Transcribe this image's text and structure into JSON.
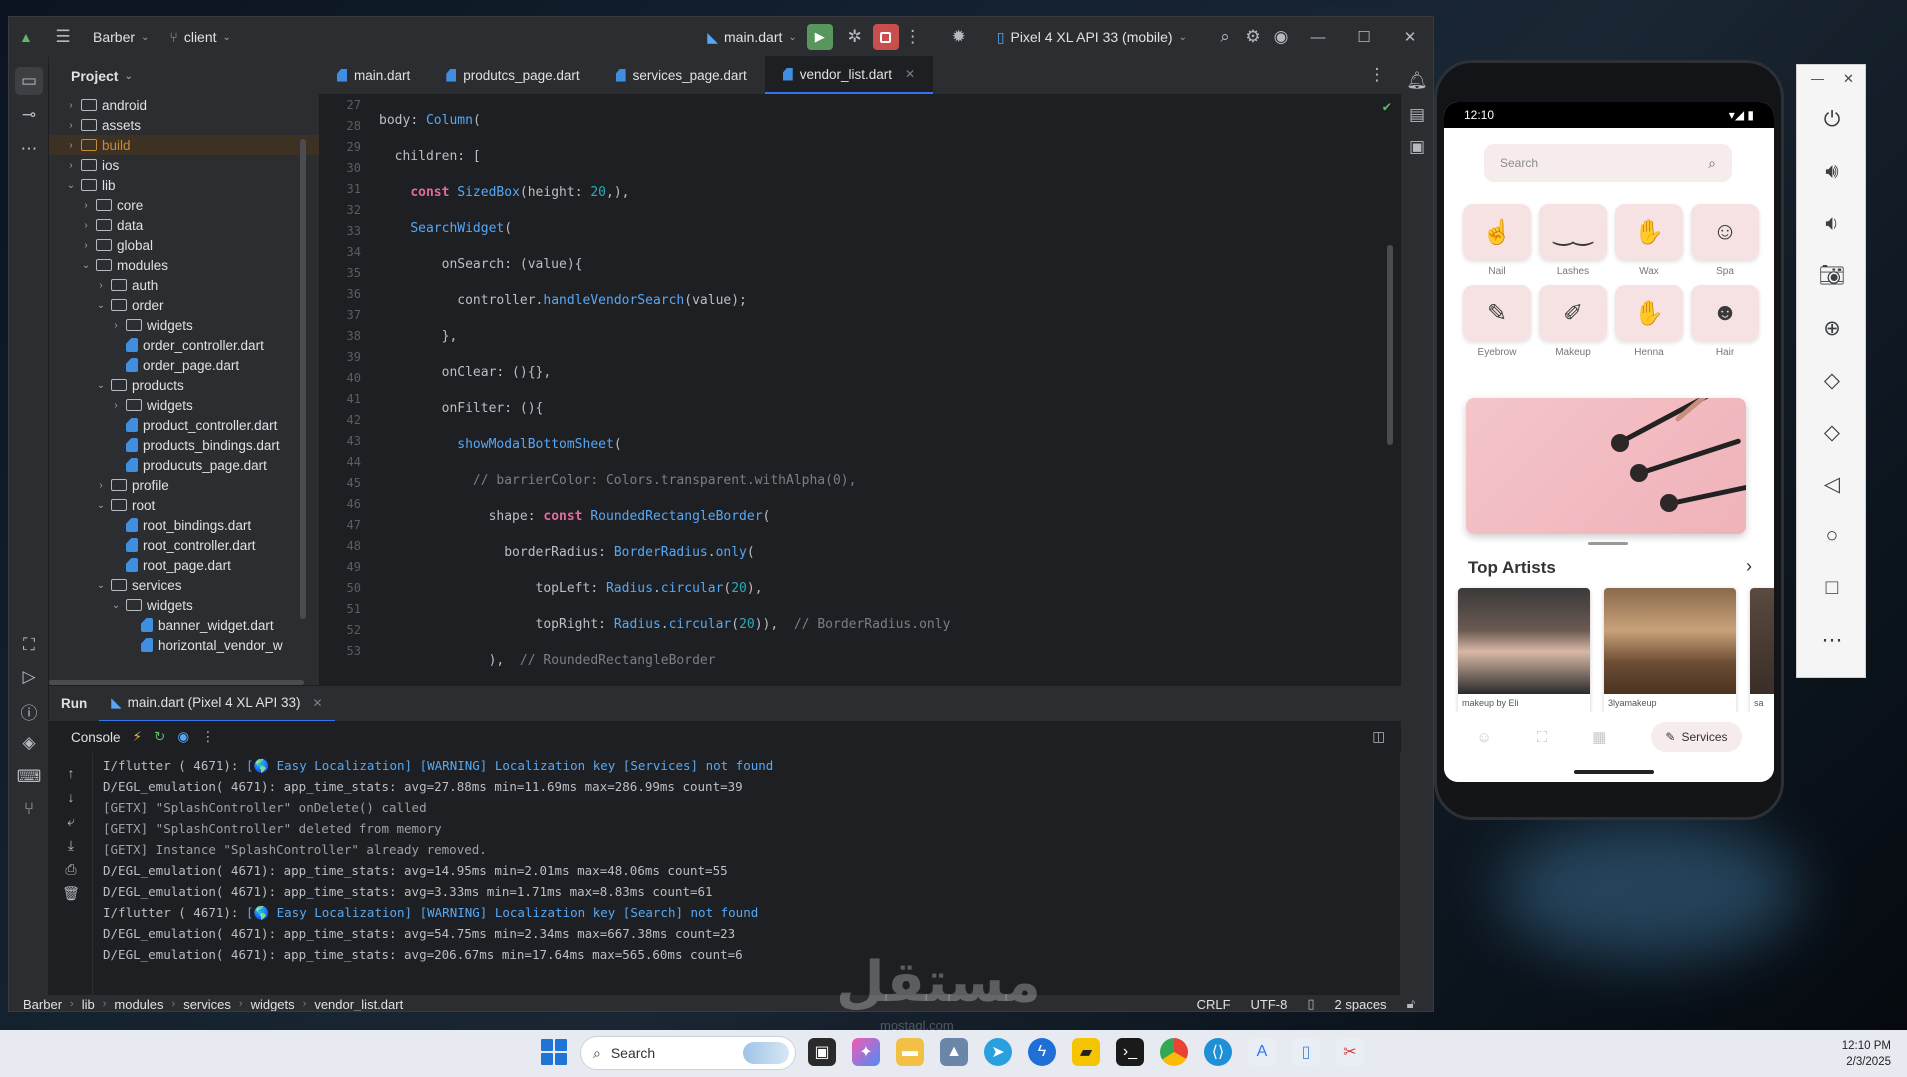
{
  "ide": {
    "project_name": "Barber",
    "vcs_branch": "client",
    "run_config": "main.dart",
    "device": "Pixel 4 XL API 33 (mobile)",
    "project_label": "Project",
    "tabs": [
      {
        "label": "main.dart"
      },
      {
        "label": "produtcs_page.dart"
      },
      {
        "label": "services_page.dart"
      },
      {
        "label": "vendor_list.dart",
        "active": true
      }
    ],
    "tree": [
      {
        "label": "android",
        "depth": 1,
        "type": "folder",
        "arrow": "›"
      },
      {
        "label": "assets",
        "depth": 1,
        "type": "folder",
        "arrow": "›"
      },
      {
        "label": "build",
        "depth": 1,
        "type": "folder-orange",
        "arrow": "›"
      },
      {
        "label": "ios",
        "depth": 1,
        "type": "folder",
        "arrow": "›"
      },
      {
        "label": "lib",
        "depth": 1,
        "type": "folder",
        "arrow": "⌄"
      },
      {
        "label": "core",
        "depth": 2,
        "type": "folder",
        "arrow": "›"
      },
      {
        "label": "data",
        "depth": 2,
        "type": "folder",
        "arrow": "›"
      },
      {
        "label": "global",
        "depth": 2,
        "type": "folder",
        "arrow": "›"
      },
      {
        "label": "modules",
        "depth": 2,
        "type": "folder",
        "arrow": "⌄"
      },
      {
        "label": "auth",
        "depth": 3,
        "type": "folder",
        "arrow": "›"
      },
      {
        "label": "order",
        "depth": 3,
        "type": "folder",
        "arrow": "⌄"
      },
      {
        "label": "widgets",
        "depth": 4,
        "type": "folder",
        "arrow": "›"
      },
      {
        "label": "order_controller.dart",
        "depth": 4,
        "type": "dart",
        "arrow": ""
      },
      {
        "label": "order_page.dart",
        "depth": 4,
        "type": "dart",
        "arrow": ""
      },
      {
        "label": "products",
        "depth": 3,
        "type": "folder",
        "arrow": "⌄"
      },
      {
        "label": "widgets",
        "depth": 4,
        "type": "folder",
        "arrow": "›"
      },
      {
        "label": "product_controller.dart",
        "depth": 4,
        "type": "dart",
        "arrow": ""
      },
      {
        "label": "products_bindings.dart",
        "depth": 4,
        "type": "dart",
        "arrow": ""
      },
      {
        "label": "producuts_page.dart",
        "depth": 4,
        "type": "dart",
        "arrow": ""
      },
      {
        "label": "profile",
        "depth": 3,
        "type": "folder",
        "arrow": "›"
      },
      {
        "label": "root",
        "depth": 3,
        "type": "folder",
        "arrow": "⌄"
      },
      {
        "label": "root_bindings.dart",
        "depth": 4,
        "type": "dart",
        "arrow": ""
      },
      {
        "label": "root_controller.dart",
        "depth": 4,
        "type": "dart",
        "arrow": ""
      },
      {
        "label": "root_page.dart",
        "depth": 4,
        "type": "dart",
        "arrow": ""
      },
      {
        "label": "services",
        "depth": 3,
        "type": "folder",
        "arrow": "⌄"
      },
      {
        "label": "widgets",
        "depth": 4,
        "type": "folder",
        "arrow": "⌄"
      },
      {
        "label": "banner_widget.dart",
        "depth": 5,
        "type": "dart",
        "arrow": ""
      },
      {
        "label": "horizontal_vendor_w",
        "depth": 5,
        "type": "dart",
        "arrow": ""
      }
    ],
    "line_numbers": [
      "27",
      "28",
      "29",
      "30",
      "31",
      "32",
      "33",
      "34",
      "35",
      "36",
      "37",
      "38",
      "39",
      "40",
      "41",
      "42",
      "43",
      "44",
      "45",
      "46",
      "47",
      "48",
      "49",
      "50",
      "51",
      "52",
      "53"
    ],
    "run_tab": "Run",
    "run_session": "main.dart (Pixel 4 XL API 33)",
    "console_label": "Console",
    "console_lines": [
      {
        "text": "I/flutter ( 4671): ",
        "rest": "[🌎 Easy Localization] [WARNING] Localization key [Services] not found",
        "kind": "warn"
      },
      {
        "text": "D/EGL_emulation( 4671): app_time_stats: avg=27.88ms min=11.69ms max=286.99ms count=39",
        "rest": "",
        "kind": "info"
      },
      {
        "text": "[GETX] \"SplashController\" onDelete() called",
        "rest": "",
        "kind": "getx"
      },
      {
        "text": "[GETX] \"SplashController\" deleted from memory",
        "rest": "",
        "kind": "getx"
      },
      {
        "text": "[GETX] Instance \"SplashController\" already removed.",
        "rest": "",
        "kind": "getx"
      },
      {
        "text": "D/EGL_emulation( 4671): app_time_stats: avg=14.95ms min=2.01ms max=48.06ms count=55",
        "rest": "",
        "kind": "info"
      },
      {
        "text": "D/EGL_emulation( 4671): app_time_stats: avg=3.33ms min=1.71ms max=8.83ms count=61",
        "rest": "",
        "kind": "info"
      },
      {
        "text": "I/flutter ( 4671): ",
        "rest": "[🌎 Easy Localization] [WARNING] Localization key [Search] not found",
        "kind": "warn"
      },
      {
        "text": "D/EGL_emulation( 4671): app_time_stats: avg=54.75ms min=2.34ms max=667.38ms count=23",
        "rest": "",
        "kind": "info"
      },
      {
        "text": "D/EGL_emulation( 4671): app_time_stats: avg=206.67ms min=17.64ms max=565.60ms count=6",
        "rest": "",
        "kind": "info"
      }
    ],
    "breadcrumb": [
      "Barber",
      "lib",
      "modules",
      "services",
      "widgets",
      "vendor_list.dart"
    ],
    "status": {
      "line_ending": "CRLF",
      "encoding": "UTF-8",
      "indent": "2 spaces"
    }
  },
  "phone": {
    "time": "12:10",
    "search_placeholder": "Search",
    "categories": [
      {
        "label": "Nail",
        "icon": "nail-icon",
        "glyph": "☝"
      },
      {
        "label": "Lashes",
        "icon": "lashes-icon",
        "glyph": "‿‿"
      },
      {
        "label": "Wax",
        "icon": "wax-icon",
        "glyph": "✋"
      },
      {
        "label": "Spa",
        "icon": "spa-icon",
        "glyph": "☺"
      },
      {
        "label": "Eyebrow",
        "icon": "eyebrow-icon",
        "glyph": "✎"
      },
      {
        "label": "Makeup",
        "icon": "makeup-icon",
        "glyph": "✐"
      },
      {
        "label": "Henna",
        "icon": "henna-icon",
        "glyph": "✋"
      },
      {
        "label": "Hair",
        "icon": "hair-icon",
        "glyph": "☻"
      }
    ],
    "top_artists_title": "Top Artists",
    "artists": [
      {
        "name": "makeup by Eli"
      },
      {
        "name": "3lyamakeup"
      },
      {
        "name": "sa"
      }
    ],
    "nav_active_label": "Services"
  },
  "watermark": {
    "arabic": "مستقل",
    "latin": "mostaql.com"
  },
  "taskbar": {
    "search_label": "Search",
    "time": "12:10 PM",
    "date": "2/3/2025"
  }
}
